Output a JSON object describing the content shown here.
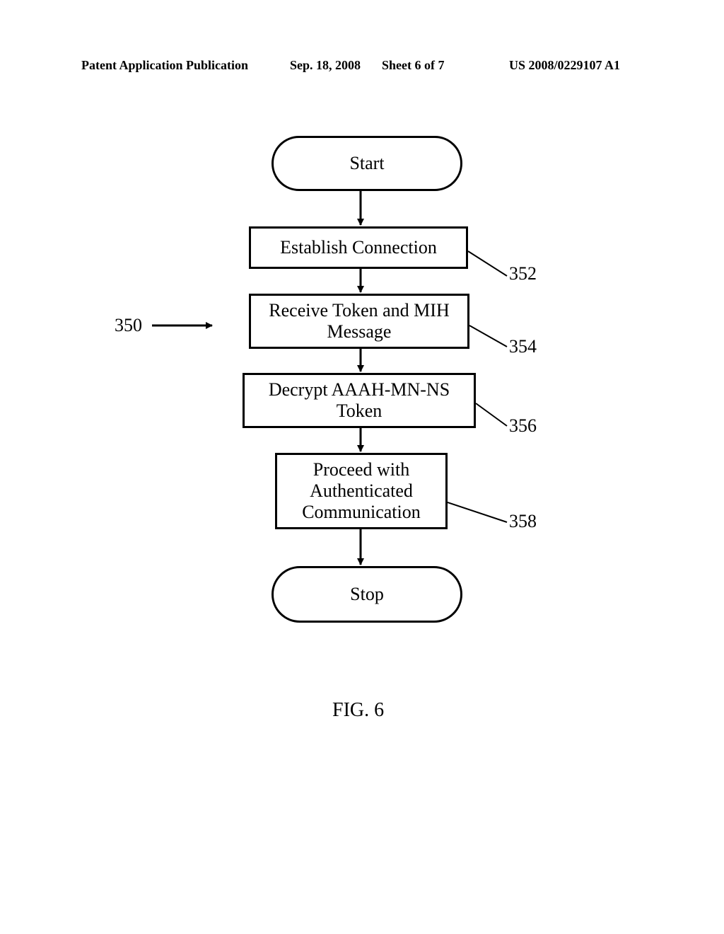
{
  "header": {
    "left": "Patent Application Publication",
    "date": "Sep. 18, 2008",
    "sheet": "Sheet 6 of 7",
    "pubnum": "US 2008/0229107 A1"
  },
  "nodes": {
    "start": "Start",
    "step1": "Establish Connection",
    "step2": "Receive Token and MIH Message",
    "step3": "Decrypt AAAH-MN-NS Token",
    "step4": "Proceed with Authenticated Communication",
    "stop": "Stop"
  },
  "refs": {
    "overall": "350",
    "r1": "352",
    "r2": "354",
    "r3": "356",
    "r4": "358"
  },
  "figure": "FIG. 6"
}
